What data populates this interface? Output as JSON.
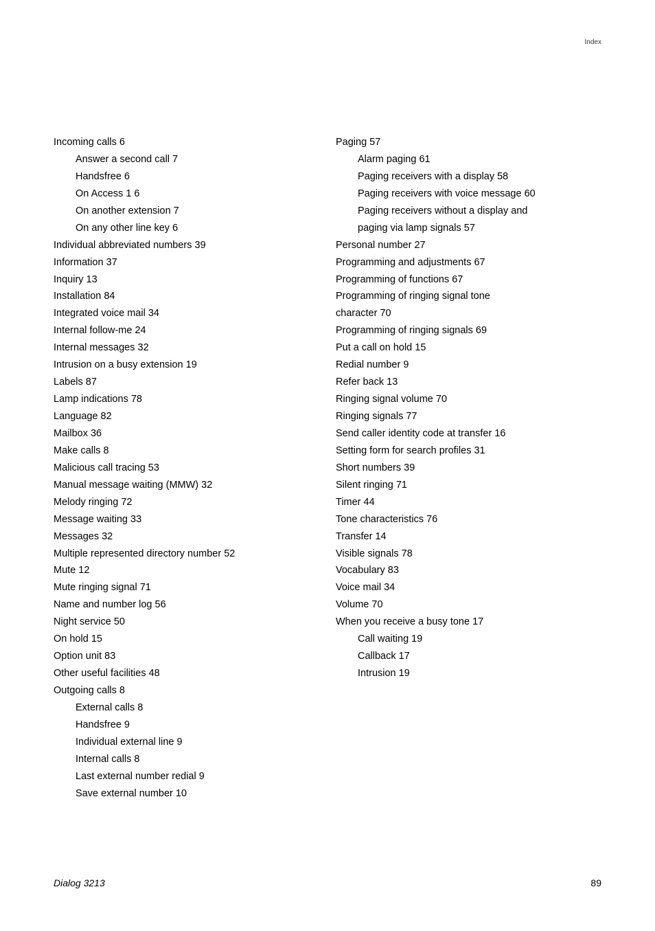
{
  "header": {
    "label": "Index"
  },
  "columns": {
    "left": [
      {
        "text": "Incoming calls 6",
        "sub": false
      },
      {
        "text": "Answer a second call 7",
        "sub": true
      },
      {
        "text": "Handsfree 6",
        "sub": true
      },
      {
        "text": "On Access 1 6",
        "sub": true
      },
      {
        "text": "On another extension 7",
        "sub": true
      },
      {
        "text": "On any other line key 6",
        "sub": true
      },
      {
        "text": "Individual abbreviated numbers 39",
        "sub": false
      },
      {
        "text": "Information 37",
        "sub": false
      },
      {
        "text": "Inquiry 13",
        "sub": false
      },
      {
        "text": "Installation 84",
        "sub": false
      },
      {
        "text": "Integrated voice mail 34",
        "sub": false
      },
      {
        "text": "Internal follow-me 24",
        "sub": false
      },
      {
        "text": "Internal messages 32",
        "sub": false
      },
      {
        "text": "Intrusion on a busy extension 19",
        "sub": false
      },
      {
        "text": "Labels 87",
        "sub": false
      },
      {
        "text": "Lamp indications 78",
        "sub": false
      },
      {
        "text": "Language 82",
        "sub": false
      },
      {
        "text": "Mailbox 36",
        "sub": false
      },
      {
        "text": "Make calls 8",
        "sub": false
      },
      {
        "text": "Malicious call tracing 53",
        "sub": false
      },
      {
        "text": "Manual message waiting (MMW) 32",
        "sub": false
      },
      {
        "text": "Melody ringing 72",
        "sub": false
      },
      {
        "text": "Message waiting 33",
        "sub": false
      },
      {
        "text": "Messages 32",
        "sub": false
      },
      {
        "text": "Multiple represented directory number 52",
        "sub": false
      },
      {
        "text": "Mute 12",
        "sub": false
      },
      {
        "text": "Mute ringing signal 71",
        "sub": false
      },
      {
        "text": "Name and number log 56",
        "sub": false
      },
      {
        "text": "Night service 50",
        "sub": false
      },
      {
        "text": "On hold 15",
        "sub": false
      },
      {
        "text": "Option unit 83",
        "sub": false
      },
      {
        "text": "Other useful facilities 48",
        "sub": false
      },
      {
        "text": "Outgoing calls 8",
        "sub": false
      },
      {
        "text": "External calls 8",
        "sub": true
      },
      {
        "text": "Handsfree 9",
        "sub": true
      },
      {
        "text": "Individual external line 9",
        "sub": true
      },
      {
        "text": "Internal calls 8",
        "sub": true
      },
      {
        "text": "Last external number redial 9",
        "sub": true
      },
      {
        "text": "Save external number 10",
        "sub": true
      }
    ],
    "right": [
      {
        "text": "Paging 57",
        "sub": false
      },
      {
        "text": "Alarm paging 61",
        "sub": true
      },
      {
        "text": "Paging receivers with a display 58",
        "sub": true
      },
      {
        "text": "Paging receivers with voice message 60",
        "sub": true
      },
      {
        "text": "Paging receivers without a display and",
        "sub": true
      },
      {
        "text": "paging via lamp signals 57",
        "sub": true
      },
      {
        "text": "Personal number 27",
        "sub": false
      },
      {
        "text": "Programming and adjustments 67",
        "sub": false
      },
      {
        "text": "Programming of functions 67",
        "sub": false
      },
      {
        "text": "Programming of ringing signal tone",
        "sub": false
      },
      {
        "text": "character 70",
        "sub": false
      },
      {
        "text": "Programming of ringing signals 69",
        "sub": false
      },
      {
        "text": "Put a call on hold 15",
        "sub": false
      },
      {
        "text": "Redial number 9",
        "sub": false
      },
      {
        "text": "Refer back 13",
        "sub": false
      },
      {
        "text": "Ringing signal volume 70",
        "sub": false
      },
      {
        "text": "Ringing signals 77",
        "sub": false
      },
      {
        "text": "Send caller identity code at transfer 16",
        "sub": false
      },
      {
        "text": "Setting form for search profiles 31",
        "sub": false
      },
      {
        "text": "Short numbers 39",
        "sub": false
      },
      {
        "text": "Silent ringing 71",
        "sub": false
      },
      {
        "text": "Timer 44",
        "sub": false
      },
      {
        "text": "Tone characteristics 76",
        "sub": false
      },
      {
        "text": "Transfer 14",
        "sub": false
      },
      {
        "text": "Visible signals 78",
        "sub": false
      },
      {
        "text": "Vocabulary 83",
        "sub": false
      },
      {
        "text": "Voice mail 34",
        "sub": false
      },
      {
        "text": "Volume 70",
        "sub": false
      },
      {
        "text": "When you receive a busy tone 17",
        "sub": false
      },
      {
        "text": "Call waiting 19",
        "sub": true
      },
      {
        "text": "Callback 17",
        "sub": true
      },
      {
        "text": "Intrusion 19",
        "sub": true
      }
    ]
  },
  "footer": {
    "left": "Dialog 3213",
    "right": "89"
  }
}
